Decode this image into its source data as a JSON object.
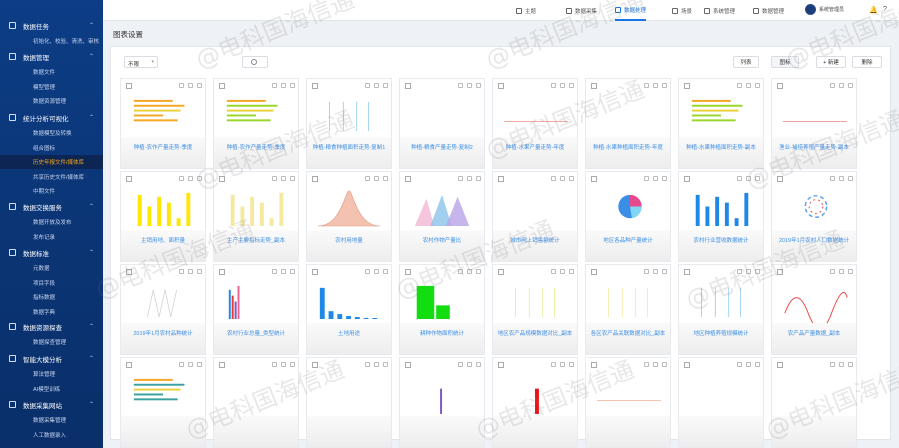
{
  "sidebar": {
    "sections": [
      {
        "label": "数据任务",
        "items": [
          "初始化、校验、清洗、审核"
        ]
      },
      {
        "label": "数据管理",
        "items": [
          "数据文件",
          "模型管理",
          "数据资源管理"
        ]
      },
      {
        "label": "统计分析可视化",
        "items": [
          "数据模型及转换",
          "组合图标",
          "历史年报文件/媒体库",
          "共享历史文件/媒体库",
          "中期文件"
        ],
        "active": "历史年报文件/媒体库"
      },
      {
        "label": "数据交换服务",
        "items": [
          "数据开放及发布",
          "发布记录"
        ]
      },
      {
        "label": "数据标准",
        "items": [
          "元数据",
          "项目字段",
          "指标数据",
          "数据字典"
        ]
      },
      {
        "label": "数据资源探查",
        "items": [
          "数据探查管理"
        ]
      },
      {
        "label": "智能大模分析",
        "items": [
          "算法管理",
          "AI模型训练"
        ]
      },
      {
        "label": "数据采集网站",
        "items": [
          "数据采集管理",
          "人工数据录入"
        ]
      }
    ]
  },
  "topbar": {
    "tabs": [
      "主题",
      "数据采集",
      "数据处理",
      "场景",
      "系统管理",
      "数据管理"
    ],
    "active_tab": "数据处理",
    "user": "系统管理员"
  },
  "page": {
    "title": "图表设置"
  },
  "toolbar": {
    "select_value": "不限",
    "list_btn": "列表",
    "grid_btn": "图标",
    "new_btn": "+ 新建",
    "delete_btn": "删除"
  },
  "watermark": "@电科国海信通",
  "cards": [
    {
      "title": "种植-农作产量走势-季度",
      "kind": "hbar",
      "color": "#f5a623"
    },
    {
      "title": "种植-农作产量走势-季度",
      "kind": "hbar",
      "color": "#9ad62a"
    },
    {
      "title": "种植-粮食种植面积走势-复制1",
      "kind": "thin",
      "color": "#4aa8e8"
    },
    {
      "title": "种植-粮食产量走势-复制2",
      "kind": "blank",
      "color": "#4aa8e8"
    },
    {
      "title": "种植-水果产量走势-年度",
      "kind": "line",
      "color": "#e84a4a"
    },
    {
      "title": "种植-水果种植面积走势-年度",
      "kind": "blank",
      "color": "#4aa8e8"
    },
    {
      "title": "种植-水果种植面积走势-副本",
      "kind": "hbar",
      "color": "#9ad62a"
    },
    {
      "title": "渔业-捕捞养殖产量走势-副本",
      "kind": "line",
      "color": "#d44"
    },
    {
      "title": "主销用地、面积量",
      "kind": "vbar",
      "color": "#ffe600"
    },
    {
      "title": "生产主要指标走势_副本",
      "kind": "vbar",
      "color": "#f5e9a0"
    },
    {
      "title": "农村用地量",
      "kind": "peak",
      "color": "#e0957a"
    },
    {
      "title": "农村作物产量比",
      "kind": "peaks",
      "color": "#8cc3ea"
    },
    {
      "title": "城市网上销售额统计",
      "kind": "blank",
      "color": "#4aa8e8"
    },
    {
      "title": "地区各品种产量统计",
      "kind": "pie",
      "color": "#3b8ee6"
    },
    {
      "title": "农村行业营收数据统计",
      "kind": "vbar",
      "color": "#1e88e5"
    },
    {
      "title": "2019年1月农村人口数据统计",
      "kind": "ring",
      "color": "#e84a4a"
    },
    {
      "title": "2019年1月农村品种统计",
      "kind": "zig",
      "color": "#ccc"
    },
    {
      "title": "农村行业总量_类型统计",
      "kind": "vbars",
      "color": "#7e57c2"
    },
    {
      "title": "土地用途",
      "kind": "decay",
      "color": "#1e88e5"
    },
    {
      "title": "耕种作物面积统计",
      "kind": "green",
      "color": "#11dd11"
    },
    {
      "title": "地区农产品规模数据对比_副本",
      "kind": "thin",
      "color": "#c6e34f"
    },
    {
      "title": "各区农产品关联数据对比_副本",
      "kind": "thin",
      "color": "#f5d76e"
    },
    {
      "title": "地区种植养殖规模统计",
      "kind": "thin",
      "color": "#4aa8e8"
    },
    {
      "title": "农产品产量数据_副本",
      "kind": "wave",
      "color": "#e84a4a"
    },
    {
      "title": "",
      "kind": "hbar",
      "color": "#3aa1a1"
    },
    {
      "title": "",
      "kind": "blank",
      "color": "#4aa8e8"
    },
    {
      "title": "",
      "kind": "blank",
      "color": "#4aa8e8"
    },
    {
      "title": "",
      "kind": "purple",
      "color": "#7e57c2"
    },
    {
      "title": "",
      "kind": "red",
      "color": "#e11"
    },
    {
      "title": "",
      "kind": "pinkline",
      "color": "#e86"
    },
    {
      "title": "",
      "kind": "blank",
      "color": "#4aa8e8"
    },
    {
      "title": "",
      "kind": "blank",
      "color": "#4aa8e8"
    }
  ]
}
